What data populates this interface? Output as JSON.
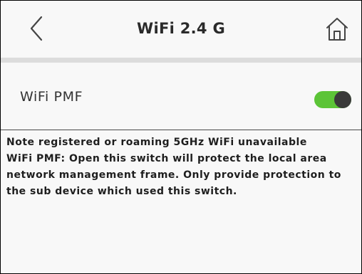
{
  "header": {
    "title": "WiFi 2.4 G",
    "back_icon": "chevron-left-icon",
    "home_icon": "home-icon"
  },
  "settings": {
    "pmf_label": "WiFi PMF",
    "pmf_enabled": true,
    "toggle_on_color": "#5cc437"
  },
  "note": {
    "line1": "Note registered or roaming 5GHz WiFi unavailable",
    "line2": "WiFi PMF: Open this switch will protect the local area network management frame. Only provide protection to the sub device which used this switch."
  }
}
